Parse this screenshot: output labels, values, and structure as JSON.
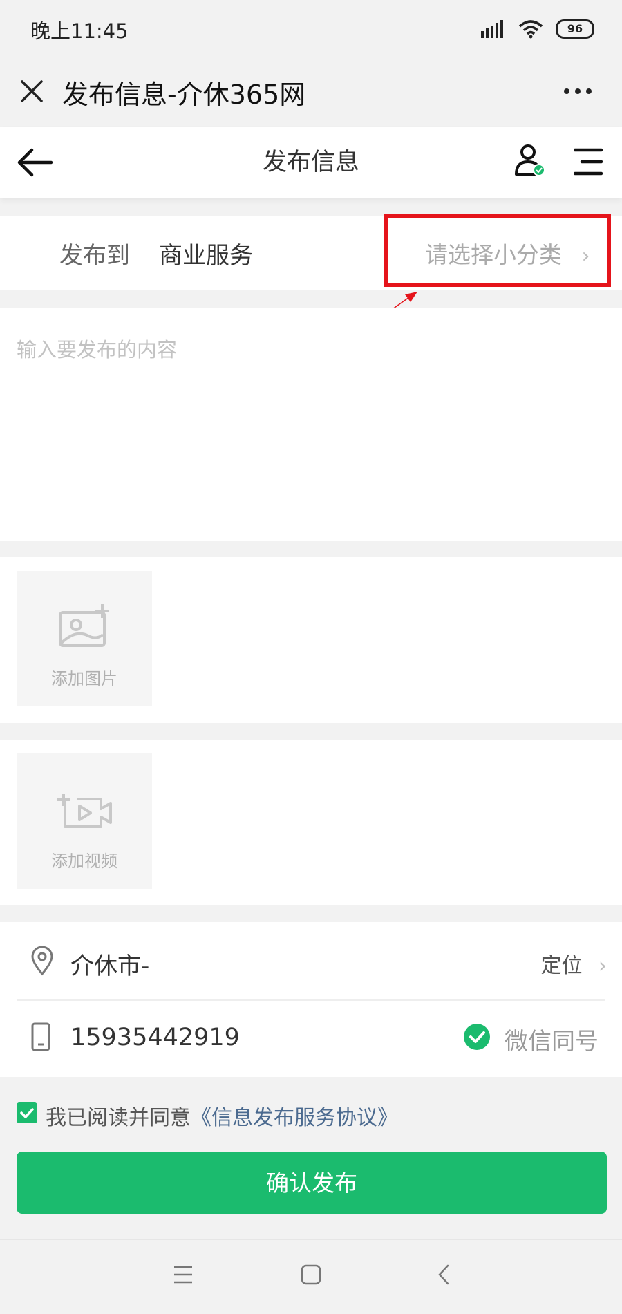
{
  "status_bar": {
    "time": "晚上11:45",
    "battery": "96",
    "icons": [
      "signal-icon",
      "wifi-icon",
      "battery-icon"
    ]
  },
  "title_bar": {
    "title": "发布信息-介休365网",
    "close_icon": "close-icon",
    "more_icon": "more-icon"
  },
  "nav_bar": {
    "title": "发布信息",
    "back_icon": "arrow-left-icon",
    "user_icon": "user-verified-icon",
    "menu_icon": "menu-icon"
  },
  "category": {
    "label": "发布到",
    "value": "商业服务",
    "subcategory_placeholder": "请选择小分类"
  },
  "content": {
    "placeholder": "输入要发布的内容"
  },
  "media": {
    "add_image": "添加图片",
    "add_video": "添加视频"
  },
  "location": {
    "city": "介休市-",
    "locate": "定位"
  },
  "phone": {
    "number": "15935442919",
    "wechat_same": "微信同号"
  },
  "agreement": {
    "text": "我已阅读并同意",
    "link": "《信息发布服务协议》",
    "checked": true
  },
  "submit_label": "确认发布",
  "colors": {
    "accent": "#1bbb6e",
    "highlight": "#e5141b",
    "link": "#4b6a8f"
  }
}
